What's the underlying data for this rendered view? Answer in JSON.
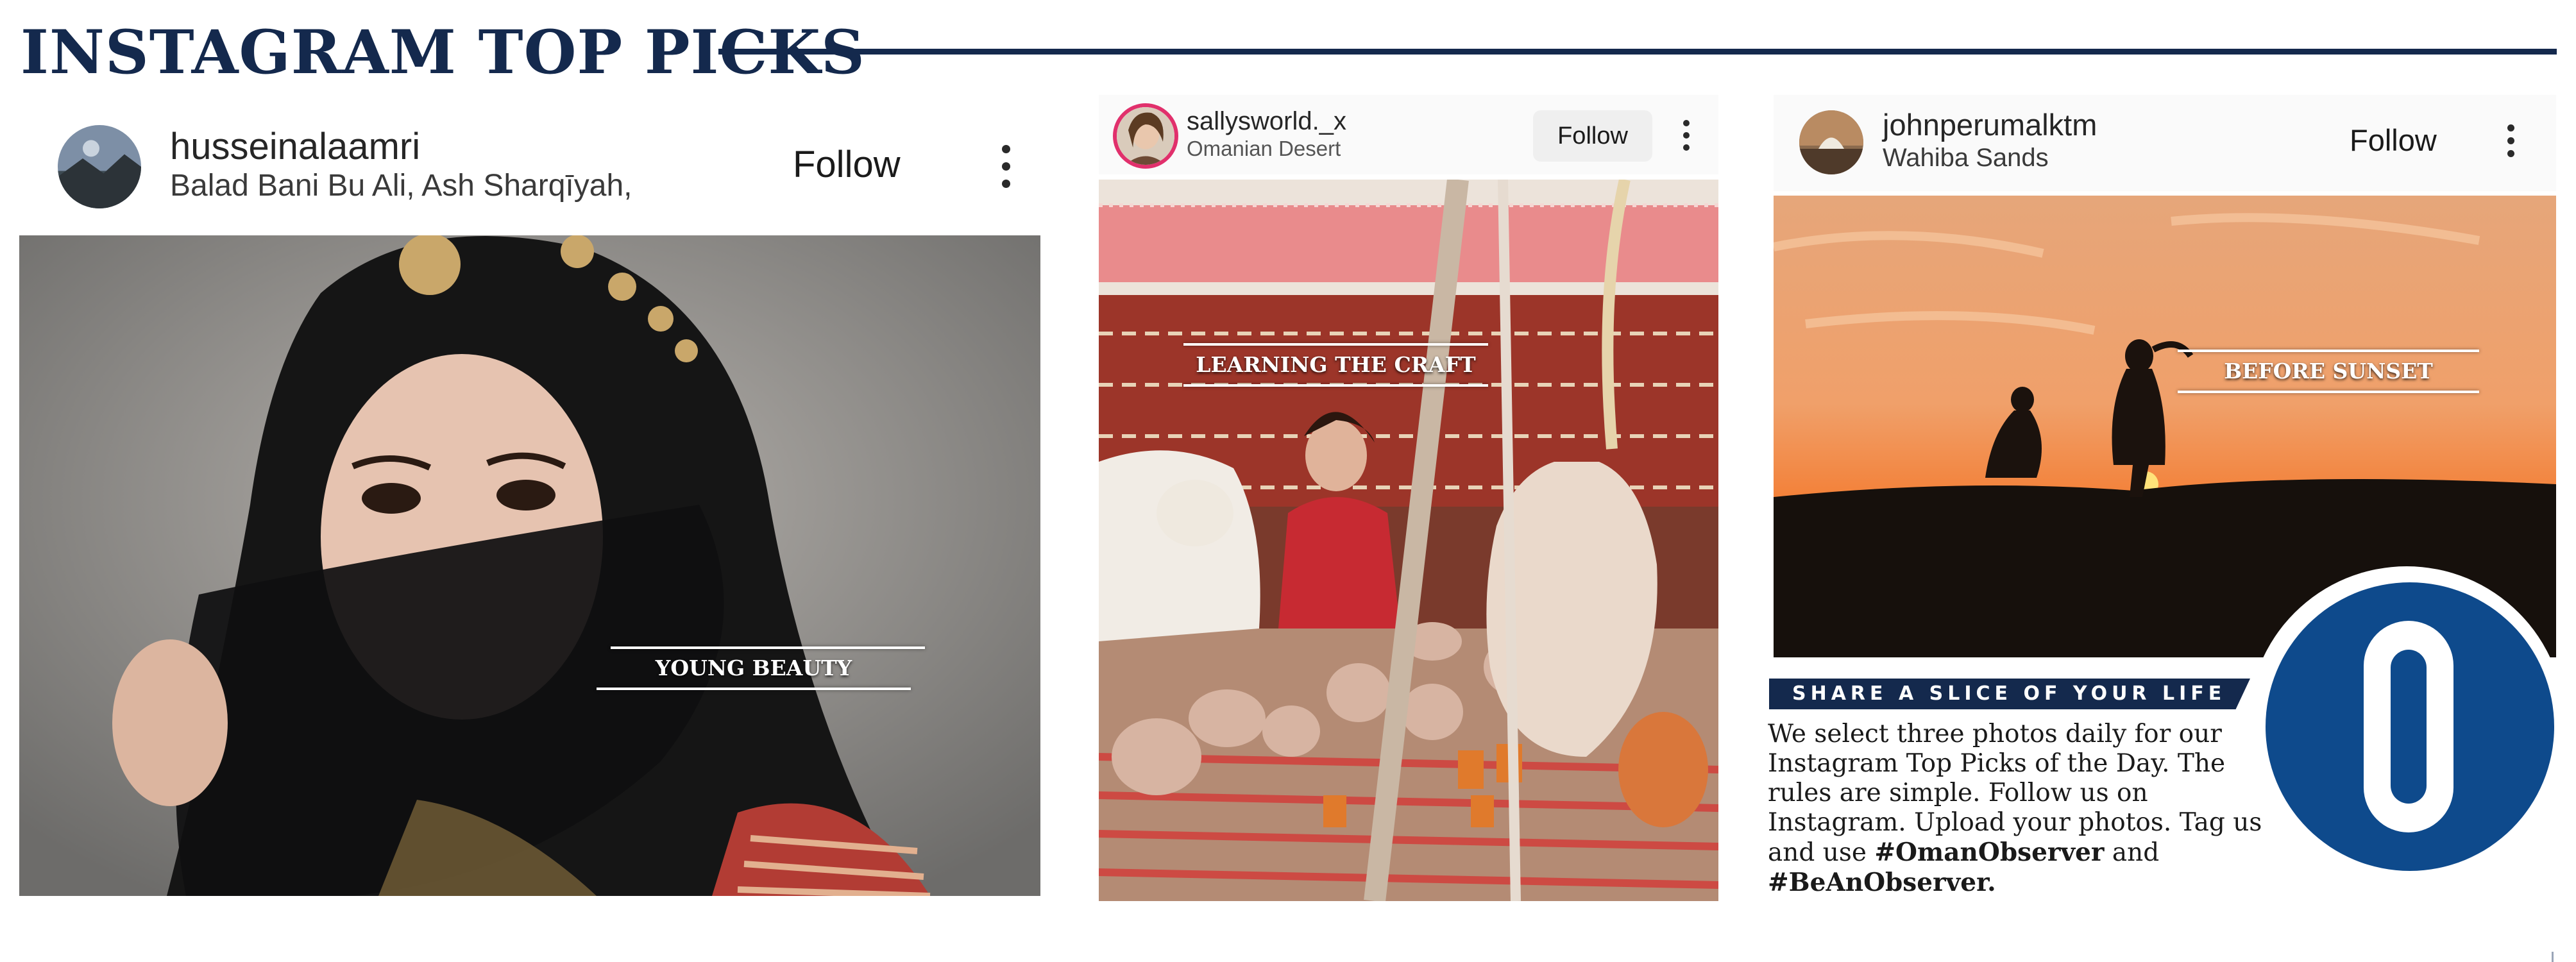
{
  "header": {
    "title": "INSTAGRAM TOP PICKS"
  },
  "posts": [
    {
      "username": "husseinalaamri",
      "location": "Balad Bani Bu Ali, Ash Sharqīyah,",
      "follow_label": "Follow",
      "caption": "YOUNG BEAUTY"
    },
    {
      "username": "sallysworld._x",
      "location": "Omanian Desert",
      "follow_label": "Follow",
      "caption": "LEARNING THE CRAFT"
    },
    {
      "username": "johnperumalktm",
      "location": "Wahiba Sands",
      "follow_label": "Follow",
      "caption": "BEFORE SUNSET"
    }
  ],
  "promo": {
    "banner": "SHARE A SLICE OF YOUR LIFE",
    "body": "We select three photos daily for our Instagram Top Picks of the Day. The rules are simple. Follow us on Instagram. Upload your photos. Tag us and use",
    "hashtag1": "#OmanObserver",
    "joiner": "and",
    "hashtag2": "#BeAnObserver."
  },
  "colors": {
    "brand_navy": "#14294d",
    "logo_blue": "#0e4a8c",
    "follow_pill": "#efefef"
  },
  "icons": [
    "more-options-icon",
    "avatar-image",
    "observer-logo"
  ]
}
